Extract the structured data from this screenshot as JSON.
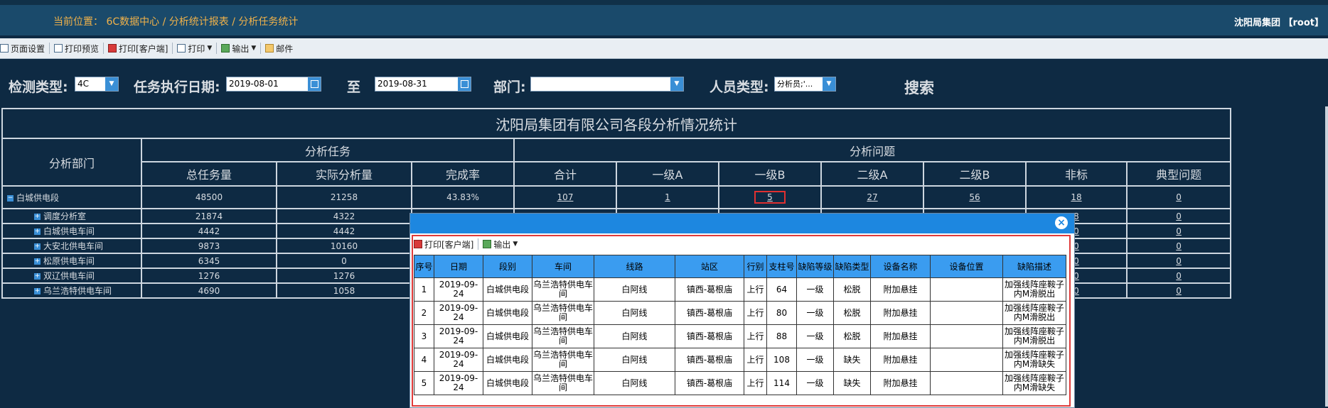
{
  "header": {
    "breadcrumb": "当前位置： 6C数据中心 / 分析统计报表 / 分析任务统计",
    "user": "沈阳局集团 【root】"
  },
  "toolbar": {
    "items": [
      {
        "label": "页面设置",
        "icon": "page-setup-icon"
      },
      {
        "label": "打印预览",
        "icon": "print-preview-icon"
      },
      {
        "label": "打印[客户端]",
        "icon": "pdf-print-icon"
      },
      {
        "label": "打印",
        "icon": "printer-icon"
      },
      {
        "label": "输出",
        "icon": "export-icon"
      },
      {
        "label": "邮件",
        "icon": "mail-icon"
      }
    ]
  },
  "filters": {
    "detect_type_label": "检测类型:",
    "detect_type_value": "4C",
    "date_label": "任务执行日期:",
    "date_from": "2019-08-01",
    "to_label": "至",
    "date_to": "2019-08-31",
    "dept_label": "部门:",
    "dept_value": "",
    "staff_label": "人员类型:",
    "staff_value": "分析员;'...",
    "search_label": "搜索"
  },
  "report": {
    "title": "沈阳局集团有限公司各段分析情况统计",
    "col_dept": "分析部门",
    "grp_task": "分析任务",
    "grp_problem": "分析问题",
    "cols": [
      "总任务量",
      "实际分析量",
      "完成率",
      "合计",
      "一级A",
      "一级B",
      "二级A",
      "二级B",
      "非标",
      "典型问题"
    ],
    "rows": [
      {
        "toggle": "−",
        "dept": "白城供电段",
        "total": "48500",
        "actual": "21258",
        "rate": "43.83%",
        "sum": "107",
        "a1": "1",
        "b1": "5",
        "a2": "27",
        "b2": "56",
        "ns": "18",
        "typ": "0"
      },
      {
        "toggle": "+",
        "dept": "调度分析室",
        "total": "21874",
        "actual": "4322",
        "rate": "",
        "sum": "",
        "a1": "",
        "b1": "",
        "a2": "",
        "b2": "",
        "ns": "8",
        "typ": "0"
      },
      {
        "toggle": "+",
        "dept": "白城供电车间",
        "total": "4442",
        "actual": "4442",
        "rate": "",
        "sum": "",
        "a1": "",
        "b1": "",
        "a2": "",
        "b2": "",
        "ns": "0",
        "typ": "0"
      },
      {
        "toggle": "+",
        "dept": "大安北供电车间",
        "total": "9873",
        "actual": "10160",
        "rate": "",
        "sum": "",
        "a1": "",
        "b1": "",
        "a2": "",
        "b2": "",
        "ns": "0",
        "typ": "0"
      },
      {
        "toggle": "+",
        "dept": "松原供电车间",
        "total": "6345",
        "actual": "0",
        "rate": "",
        "sum": "",
        "a1": "",
        "b1": "",
        "a2": "",
        "b2": "",
        "ns": "0",
        "typ": "0"
      },
      {
        "toggle": "+",
        "dept": "双辽供电车间",
        "total": "1276",
        "actual": "1276",
        "rate": "",
        "sum": "",
        "a1": "",
        "b1": "",
        "a2": "",
        "b2": "",
        "ns": "0",
        "typ": "0"
      },
      {
        "toggle": "+",
        "dept": "乌兰浩特供电车间",
        "total": "4690",
        "actual": "1058",
        "rate": "",
        "sum": "",
        "a1": "",
        "b1": "",
        "a2": "",
        "b2": "",
        "ns": "0",
        "typ": "0"
      }
    ]
  },
  "popup": {
    "print_label": "打印[客户端]",
    "export_label": "输出",
    "cols": [
      "序号",
      "日期",
      "段别",
      "车间",
      "线路",
      "站区",
      "行别",
      "支柱号",
      "缺陷等级",
      "缺陷类型",
      "设备名称",
      "设备位置",
      "缺陷描述"
    ],
    "rows": [
      [
        "1",
        "2019-09-24",
        "白城供电段",
        "乌兰浩特供电车间",
        "白阿线",
        "镇西-葛根庙",
        "上行",
        "64",
        "一级",
        "松脱",
        "附加悬挂",
        "",
        "加强线阵座鞍子内M滑脱出"
      ],
      [
        "2",
        "2019-09-24",
        "白城供电段",
        "乌兰浩特供电车间",
        "白阿线",
        "镇西-葛根庙",
        "上行",
        "80",
        "一级",
        "松脱",
        "附加悬挂",
        "",
        "加强线阵座鞍子内M滑脱出"
      ],
      [
        "3",
        "2019-09-24",
        "白城供电段",
        "乌兰浩特供电车间",
        "白阿线",
        "镇西-葛根庙",
        "上行",
        "88",
        "一级",
        "松脱",
        "附加悬挂",
        "",
        "加强线阵座鞍子内M滑脱出"
      ],
      [
        "4",
        "2019-09-24",
        "白城供电段",
        "乌兰浩特供电车间",
        "白阿线",
        "镇西-葛根庙",
        "上行",
        "108",
        "一级",
        "缺失",
        "附加悬挂",
        "",
        "加强线阵座鞍子内M滑缺失"
      ],
      [
        "5",
        "2019-09-24",
        "白城供电段",
        "乌兰浩特供电车间",
        "白阿线",
        "镇西-葛根庙",
        "上行",
        "114",
        "一级",
        "缺失",
        "附加悬挂",
        "",
        "加强线阵座鞍子内M滑缺失"
      ]
    ]
  }
}
